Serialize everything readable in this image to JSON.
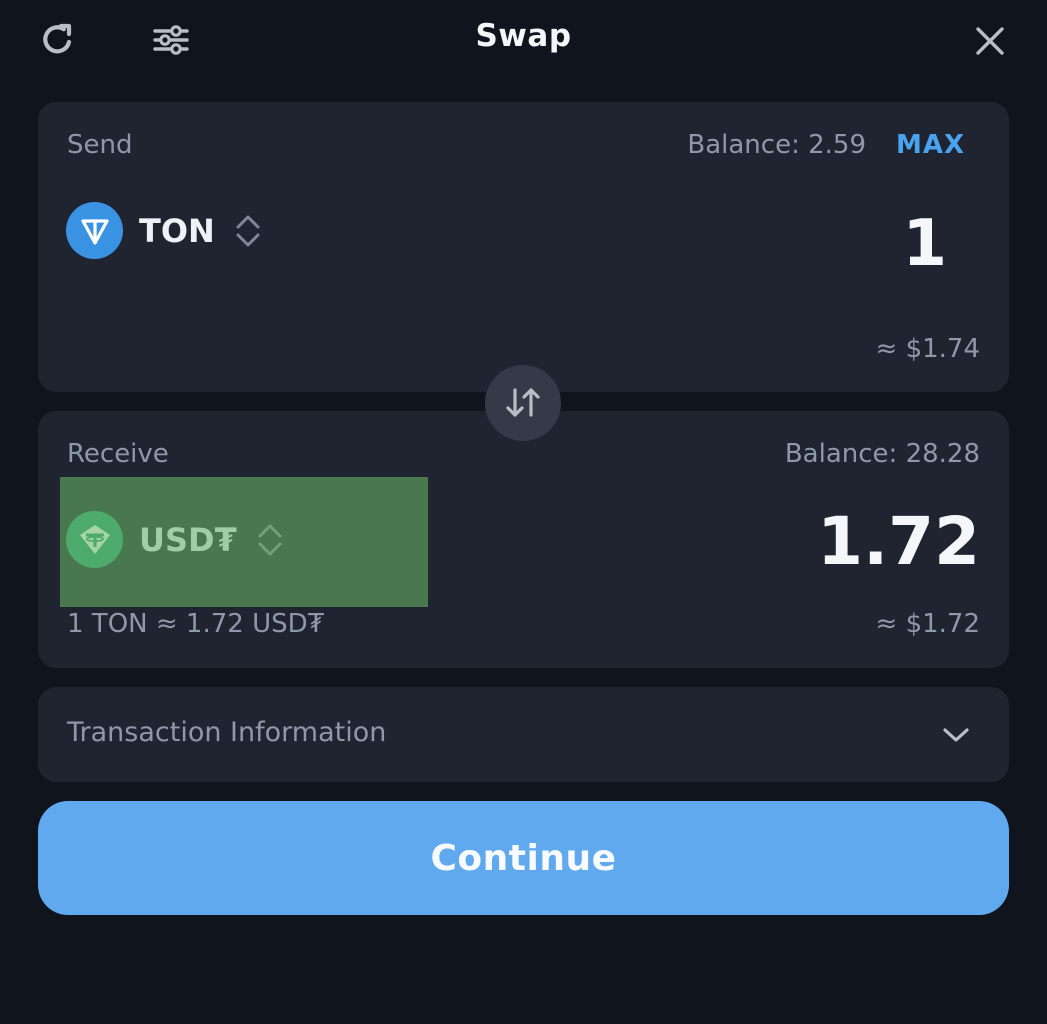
{
  "header": {
    "title": "Swap",
    "refresh_icon": "refresh-icon",
    "settings_icon": "sliders-icon",
    "close_icon": "close-icon"
  },
  "send": {
    "label": "Send",
    "balance": "Balance: 2.59",
    "max_label": "MAX",
    "token": "TON",
    "amount": "1",
    "fiat": "≈ $1.74"
  },
  "receive": {
    "label": "Receive",
    "balance": "Balance: 28.28",
    "token": "USD₮",
    "amount": "1.72",
    "fiat": "≈ $1.72",
    "rate": "1 TON ≈ 1.72 USD₮"
  },
  "transaction_info": {
    "label": "Transaction Information"
  },
  "continue_label": "Continue",
  "colors": {
    "background": "#10151d",
    "card": "#1f2430",
    "accent": "#4aa3ee",
    "button": "#61a9ef",
    "ton": "#0f8fe6",
    "usdt": "#27a17a",
    "highlight": "#4f8d4b"
  }
}
